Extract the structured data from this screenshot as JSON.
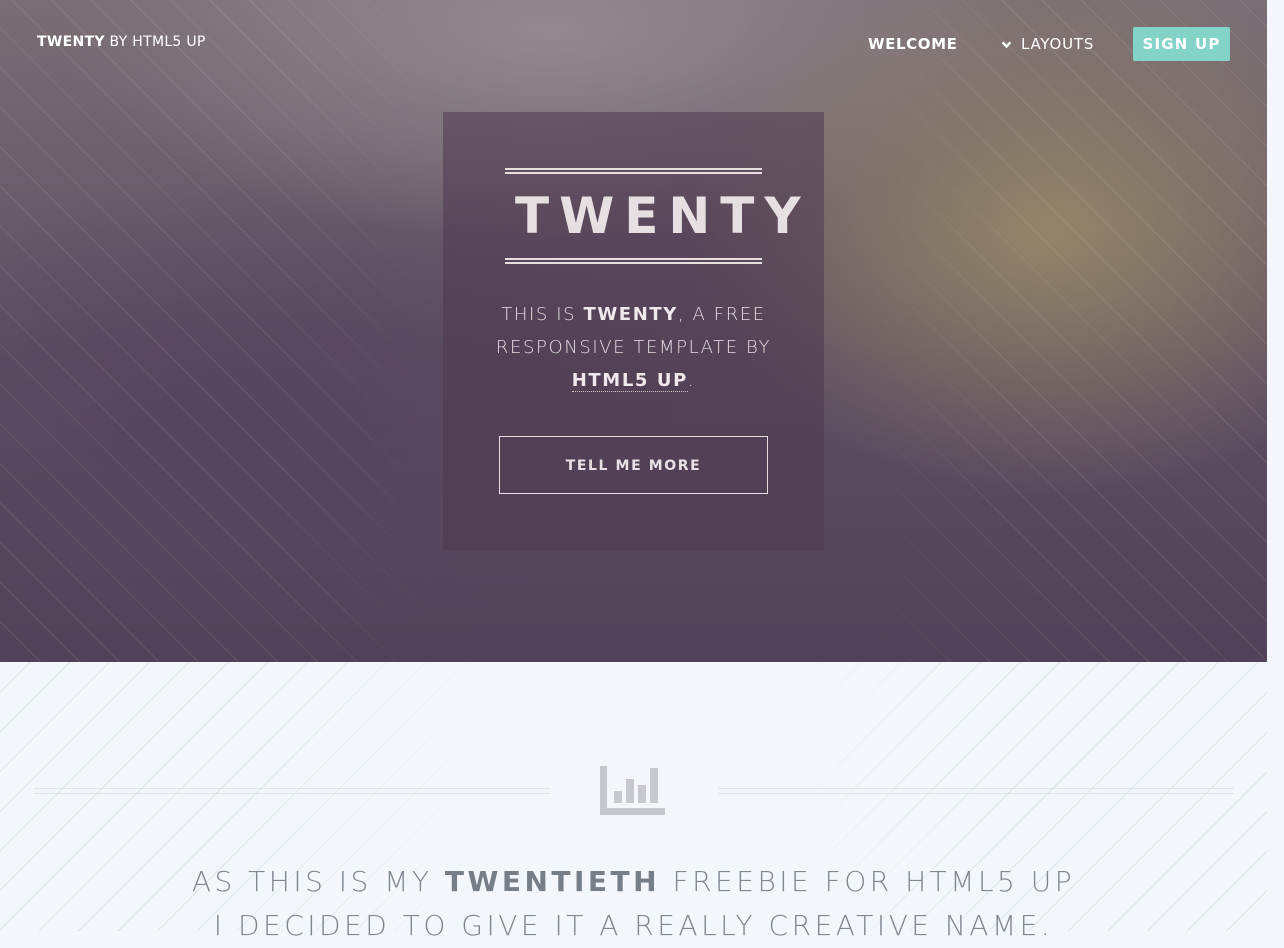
{
  "header": {
    "logo_bold": "TWENTY",
    "logo_rest": "BY HTML5 UP",
    "nav": {
      "welcome": "WELCOME",
      "layouts": "LAYOUTS",
      "signup": "SIGN UP"
    }
  },
  "hero": {
    "title": "TWENTY",
    "tagline": {
      "pre": "THIS IS ",
      "brand": "TWENTY",
      "mid": ", A FREE RESPONSIVE TEMPLATE BY ",
      "link": "HTML5 UP",
      "end": "."
    },
    "button": "TELL ME MORE"
  },
  "intro": {
    "icon": "bar-chart-icon",
    "line1_pre": "AS THIS IS MY ",
    "line1_bold": "TWENTIETH",
    "line1_post": " FREEBIE FOR HTML5 UP",
    "line2": "I DECIDED TO GIVE IT A REALLY CREATIVE NAME."
  },
  "colors": {
    "signup_bg": "#83d3c9",
    "hero_dark": "#514259",
    "page_bg": "#f3f6fa"
  }
}
